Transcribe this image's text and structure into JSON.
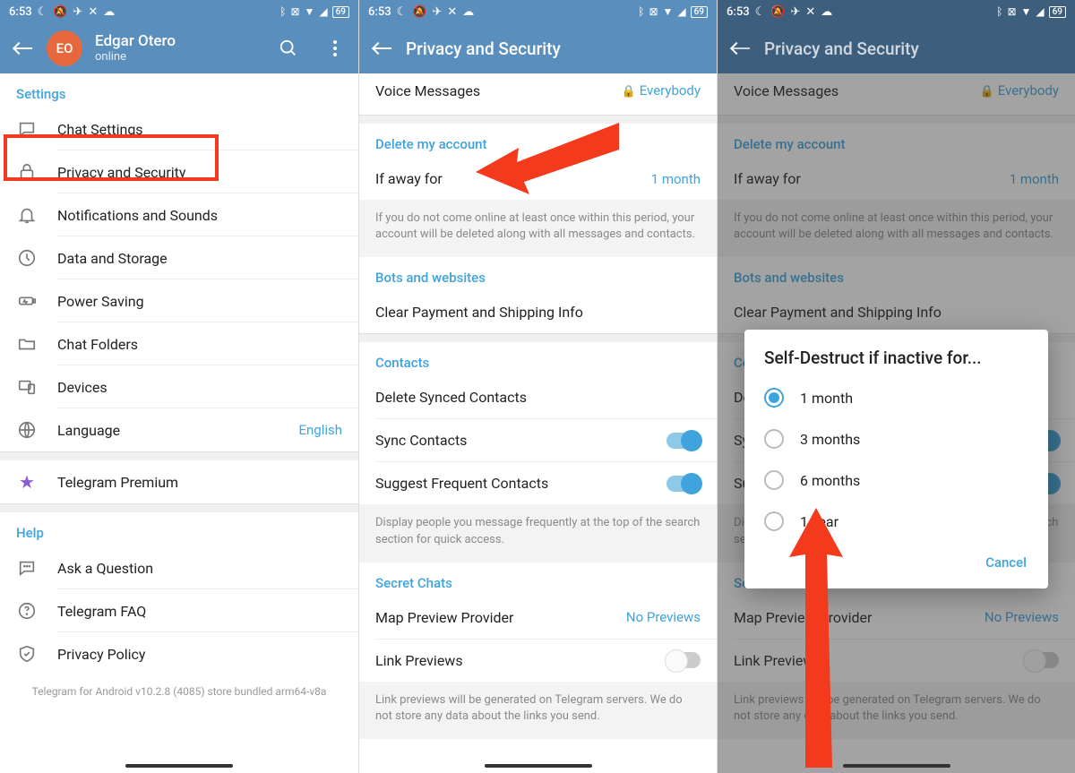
{
  "status": {
    "time": "6:53",
    "battery": "69"
  },
  "panel1": {
    "profile": {
      "initials": "EO",
      "name": "Edgar Otero",
      "status": "online"
    },
    "settings_header": "Settings",
    "items": [
      {
        "label": "Chat Settings"
      },
      {
        "label": "Privacy and Security"
      },
      {
        "label": "Notifications and Sounds"
      },
      {
        "label": "Data and Storage"
      },
      {
        "label": "Power Saving"
      },
      {
        "label": "Chat Folders"
      },
      {
        "label": "Devices"
      },
      {
        "label": "Language",
        "value": "English"
      }
    ],
    "premium": "Telegram Premium",
    "help_header": "Help",
    "help_items": [
      {
        "label": "Ask a Question"
      },
      {
        "label": "Telegram FAQ"
      },
      {
        "label": "Privacy Policy"
      }
    ],
    "footer": "Telegram for Android v10.2.8 (4085) store bundled arm64-v8a"
  },
  "panel2": {
    "title": "Privacy and Security",
    "voice_messages": {
      "label": "Voice Messages",
      "value": "Everybody"
    },
    "delete_header": "Delete my account",
    "if_away": {
      "label": "If away for",
      "value": "1 month"
    },
    "if_away_info": "If you do not come online at least once within this period, your account will be deleted along with all messages and contacts.",
    "bots_header": "Bots and websites",
    "clear_payment": "Clear Payment and Shipping Info",
    "contacts_header": "Contacts",
    "delete_synced": "Delete Synced Contacts",
    "sync_contacts": "Sync Contacts",
    "suggest_frequent": "Suggest Frequent Contacts",
    "suggest_info": "Display people you message frequently at the top of the search section for quick access.",
    "secret_header": "Secret Chats",
    "map_preview": {
      "label": "Map Preview Provider",
      "value": "No Previews"
    },
    "link_previews": "Link Previews",
    "link_info": "Link previews will be generated on Telegram servers. We do not store any data about the links you send."
  },
  "panel3": {
    "dialog_title": "Self-Destruct if inactive for...",
    "options": [
      "1 month",
      "3 months",
      "6 months",
      "1 year"
    ],
    "cancel": "Cancel"
  }
}
